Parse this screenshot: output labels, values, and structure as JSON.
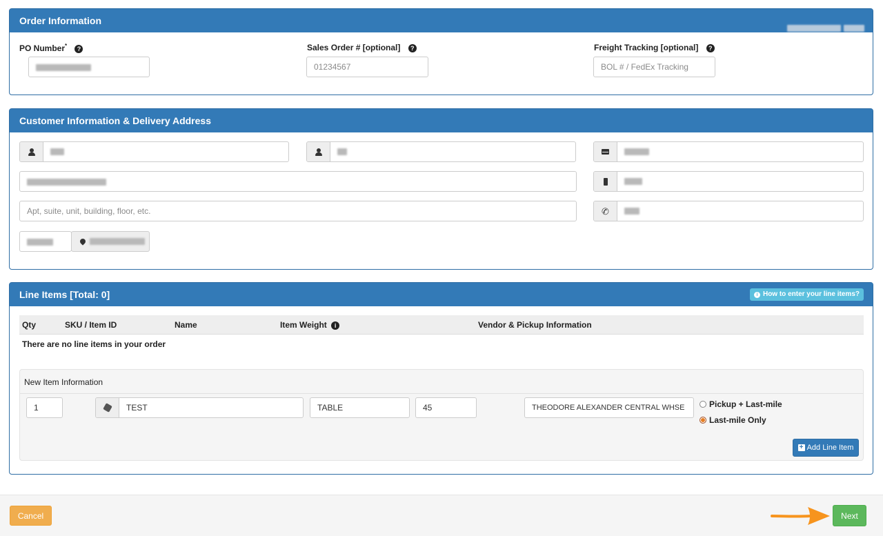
{
  "order": {
    "title": "Order Information",
    "po_label": "PO Number",
    "po_required_mark": "*",
    "po_value": "",
    "sales_label": "Sales Order # [optional]",
    "sales_placeholder": "01234567",
    "freight_label": "Freight Tracking [optional]",
    "freight_placeholder": "BOL # / FedEx Tracking"
  },
  "customer": {
    "title": "Customer Information & Delivery Address",
    "address2_placeholder": "Apt, suite, unit, building, floor, etc."
  },
  "line_items": {
    "title": "Line Items [Total: 0]",
    "help_button": "How to enter your line items?",
    "columns": [
      "Qty",
      "SKU / Item ID",
      "Name",
      "Item Weight",
      "Vendor & Pickup Information"
    ],
    "empty_message": "There are no line items in your order",
    "new_item": {
      "heading": "New Item Information",
      "qty": "1",
      "sku": "TEST",
      "name": "TABLE",
      "weight": "45",
      "vendor": "THEODORE ALEXANDER CENTRAL WHSE",
      "options": [
        "Pickup + Last-mile",
        "Last-mile Only"
      ],
      "selected_option": "Last-mile Only",
      "add_button": "Add Line Item"
    }
  },
  "footer": {
    "cancel_label": "Cancel",
    "next_label": "Next"
  },
  "colors": {
    "heading": "#337ab7",
    "cancel": "#f0ad4e",
    "next": "#5cb85c",
    "info": "#5bc0de",
    "arrow": "#f7941d"
  }
}
